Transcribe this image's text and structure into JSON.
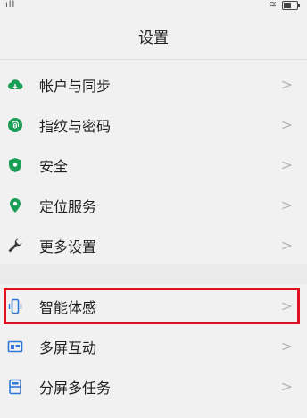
{
  "status_bar": {
    "signal": "ıll",
    "wifi": "≋",
    "battery_level": 0.55
  },
  "header": {
    "title": "设置"
  },
  "group1": [
    {
      "label": "帐户与同步",
      "icon": "cloud-icon"
    },
    {
      "label": "指纹与密码",
      "icon": "fingerprint-icon"
    },
    {
      "label": "安全",
      "icon": "shield-icon"
    },
    {
      "label": "定位服务",
      "icon": "location-pin-icon"
    },
    {
      "label": "更多设置",
      "icon": "wrench-icon"
    }
  ],
  "group2": [
    {
      "label": "智能体感",
      "icon": "phone-motion-icon",
      "highlighted": true
    },
    {
      "label": "多屏互动",
      "icon": "multiscreen-icon"
    },
    {
      "label": "分屏多任务",
      "icon": "split-screen-icon"
    }
  ],
  "chevron": ">",
  "colors": {
    "green": "#1a9e55",
    "blue": "#2f78d6",
    "highlight": "#e0101e"
  }
}
